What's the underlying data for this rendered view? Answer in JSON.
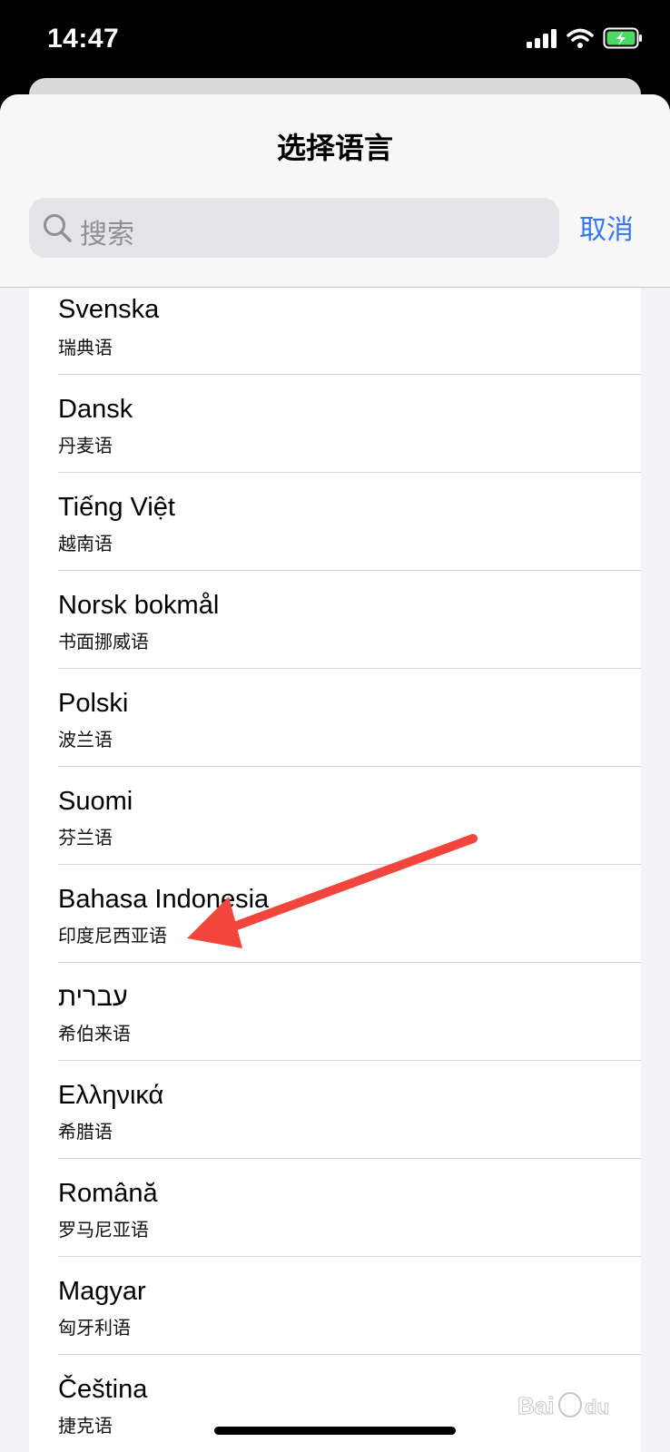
{
  "status_bar": {
    "time": "14:47"
  },
  "sheet": {
    "title": "选择语言",
    "search": {
      "placeholder": "搜索"
    },
    "cancel_label": "取消"
  },
  "languages": [
    {
      "name": "Svenska",
      "native": "瑞典语"
    },
    {
      "name": "Dansk",
      "native": "丹麦语"
    },
    {
      "name": "Tiếng Việt",
      "native": "越南语"
    },
    {
      "name": "Norsk bokmål",
      "native": "书面挪威语"
    },
    {
      "name": "Polski",
      "native": "波兰语"
    },
    {
      "name": "Suomi",
      "native": "芬兰语"
    },
    {
      "name": "Bahasa Indonesia",
      "native": "印度尼西亚语"
    },
    {
      "name": "עברית",
      "native": "希伯来语"
    },
    {
      "name": "Ελληνικά",
      "native": "希腊语"
    },
    {
      "name": "Română",
      "native": "罗马尼亚语"
    },
    {
      "name": "Magyar",
      "native": "匈牙利语"
    },
    {
      "name": "Čeština",
      "native": "捷克语"
    }
  ],
  "colors": {
    "accent": "#3478f6",
    "annotation_arrow": "#f2453c",
    "battery": "#4cd964"
  },
  "icons": [
    "signal-icon",
    "wifi-icon",
    "battery-charging-icon",
    "search-icon"
  ]
}
